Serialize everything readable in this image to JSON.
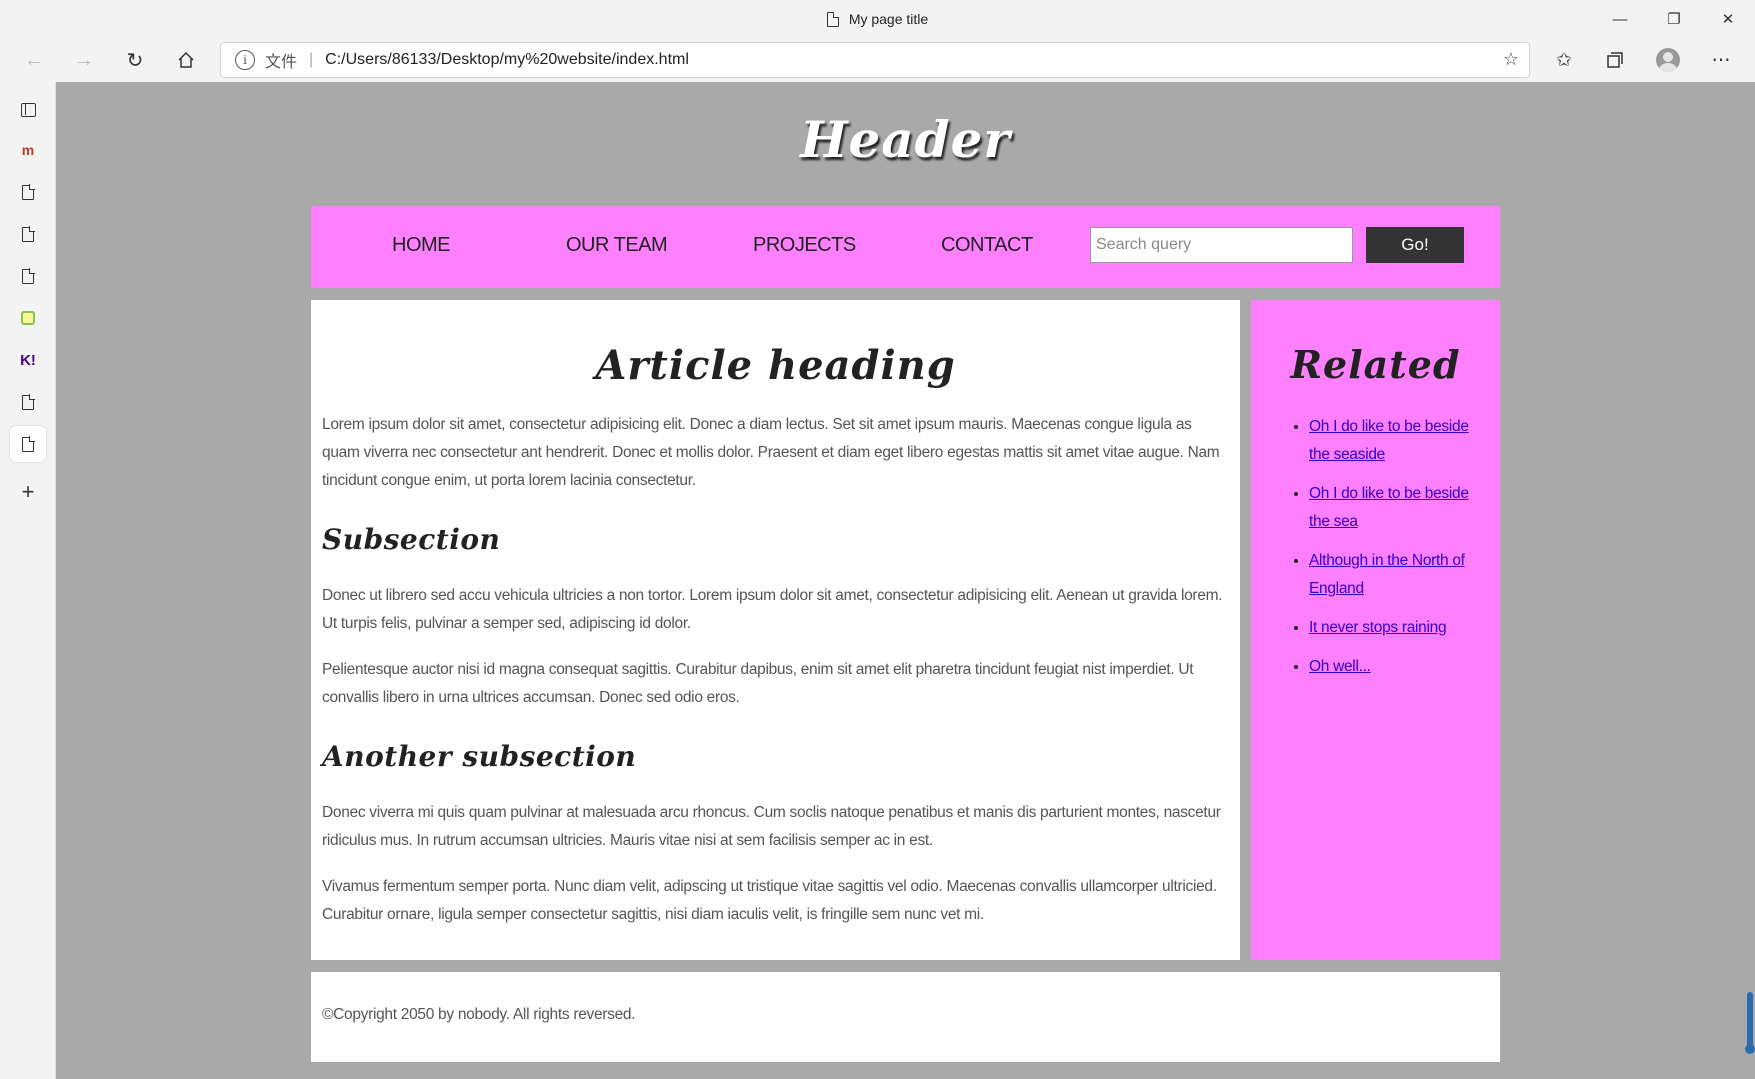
{
  "browser": {
    "tab_title": "My page title",
    "address": {
      "scheme_label": "文件",
      "url": "C:/Users/86133/Desktop/my%20website/index.html"
    },
    "window_controls": {
      "minimize": "—",
      "restore": "❐",
      "close": "✕"
    }
  },
  "page": {
    "header": "Header",
    "nav": {
      "items": [
        "HOME",
        "OUR TEAM",
        "PROJECTS",
        "CONTACT"
      ],
      "search_placeholder": "Search query",
      "go_label": "Go!"
    },
    "article": {
      "heading": "Article heading",
      "intro": "Lorem ipsum dolor sit amet, consectetur adipisicing elit. Donec a diam lectus. Set sit amet ipsum mauris. Maecenas congue ligula as quam viverra nec consectetur ant hendrerit. Donec et mollis dolor. Praesent et diam eget libero egestas mattis sit amet vitae augue. Nam tincidunt congue enim, ut porta lorem lacinia consectetur.",
      "subsection1": {
        "heading": "Subsection",
        "p1": "Donec ut librero sed accu vehicula ultricies a non tortor. Lorem ipsum dolor sit amet, consectetur adipisicing elit. Aenean ut gravida lorem. Ut turpis felis, pulvinar a semper sed, adipiscing id dolor.",
        "p2": "Pelientesque auctor nisi id magna consequat sagittis. Curabitur dapibus, enim sit amet elit pharetra tincidunt feugiat nist imperdiet. Ut convallis libero in urna ultrices accumsan. Donec sed odio eros."
      },
      "subsection2": {
        "heading": "Another subsection",
        "p1": "Donec viverra mi quis quam pulvinar at malesuada arcu rhoncus. Cum soclis natoque penatibus et manis dis parturient montes, nascetur ridiculus mus. In rutrum accumsan ultricies. Mauris vitae nisi at sem facilisis semper ac in est.",
        "p2": "Vivamus fermentum semper porta. Nunc diam velit, adipscing ut tristique vitae sagittis vel odio. Maecenas convallis ullamcorper ultricied. Curabitur ornare, ligula semper consectetur sagittis, nisi diam iaculis velit, is fringille sem nunc vet mi."
      }
    },
    "aside": {
      "heading": "Related",
      "links": [
        "Oh I do like to be beside the seaside",
        "Oh I do like to be beside the sea",
        "Although in the North of England",
        "It never stops raining",
        "Oh well..."
      ]
    },
    "footer": "©Copyright 2050 by nobody. All rights reversed."
  },
  "colors": {
    "page_bg": "#a9a9a9",
    "accent_pink": "#ff80ff",
    "button_dark": "#333333",
    "link": "#3300cc"
  }
}
